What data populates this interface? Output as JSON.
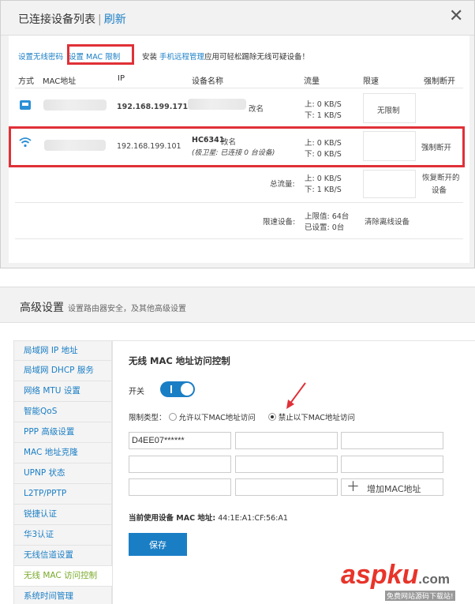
{
  "top": {
    "title": "已连接设备列表",
    "refresh": "刷新",
    "close": "✕",
    "toolbar": {
      "wifi_password": "设置无线密码",
      "mac_limit": "设置 MAC 限制",
      "install": "安装",
      "remote_mgmt": "手机远程管理",
      "remote_desc": "应用可轻松踢除无线可疑设备！"
    },
    "headers": [
      "方式",
      "MAC地址",
      "IP",
      "设备名称",
      "流量",
      "限速",
      "强制断开"
    ],
    "rows": [
      {
        "ip": "192.168.199.171",
        "rename": "改名",
        "up": "上: 0 KB/S",
        "down": "下: 1 KB/S",
        "limit": "无限制"
      },
      {
        "ip": "192.168.199.101",
        "name": "HC6341",
        "rename": "改名",
        "sub": "(极卫星: 已连接 0 台设备)",
        "up": "上: 0 KB/S",
        "down": "下: 0 KB/S",
        "disconnect": "强制断开"
      }
    ],
    "total": {
      "label": "总流量:",
      "up": "上: 0 KB/S",
      "down": "下: 1 KB/S",
      "restore": "恢复断开的",
      "restore2": "设备"
    },
    "limit_devices": {
      "label": "限速设备:",
      "max": "上限值: 64台",
      "set": "已设置: 0台",
      "clear": "清除离线设备"
    }
  },
  "advanced": {
    "title": "高级设置",
    "subtitle": "设置路由器安全，及其他高级设置",
    "menu": [
      "局域网 IP 地址",
      "局域网 DHCP 服务",
      "网络 MTU 设置",
      "智能QoS",
      "PPP 高级设置",
      "MAC 地址克隆",
      "UPNP 状态",
      "L2TP/PPTP",
      "锐捷认证",
      "华3认证",
      "无线信道设置",
      "无线 MAC 访问控制",
      "系统时间管理"
    ],
    "active_menu_index": 11,
    "section_title": "无线 MAC 地址访问控制",
    "switch_label": "开关",
    "switch_on": true,
    "limit_type_label": "限制类型：",
    "option_allow": "允许以下MAC地址访问",
    "option_deny": "禁止以下MAC地址访问",
    "selected_option": "deny",
    "mac_entries": [
      "D4EE07******",
      "",
      "",
      "",
      "",
      "",
      "",
      ""
    ],
    "add_mac": "增加MAC地址",
    "current_mac_label": "当前使用设备 MAC 地址:",
    "current_mac": "44:1E:A1:CF:56:A1",
    "save": "保存"
  },
  "watermark": {
    "asp": "asp",
    "ku": "ku",
    "com": ".com",
    "sub": "免费网站源码下载站!"
  },
  "colors": {
    "link": "#1a7ec5",
    "highlight": "#e03037",
    "active_menu": "#78a928",
    "button": "#1a7ec5"
  }
}
